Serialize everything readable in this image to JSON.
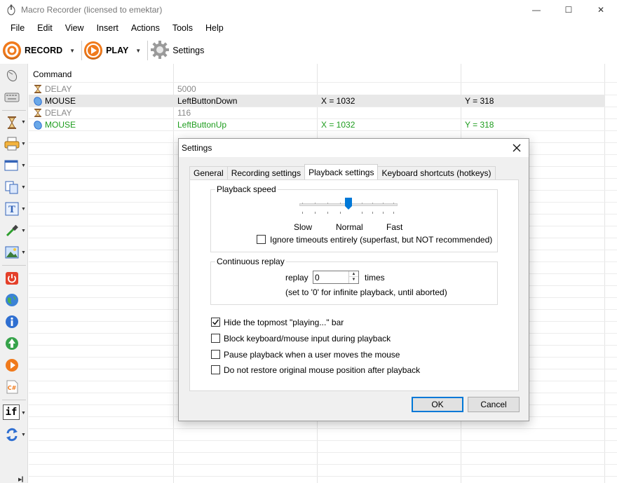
{
  "window": {
    "title": "Macro Recorder (licensed to emektar)",
    "controls": {
      "minimize": "—",
      "maximize": "☐",
      "close": "✕"
    }
  },
  "menubar": [
    "File",
    "Edit",
    "View",
    "Insert",
    "Actions",
    "Tools",
    "Help"
  ],
  "toolbar": {
    "record_label": "RECORD",
    "play_label": "PLAY",
    "settings_label": "Settings",
    "accent": "#f07a1c"
  },
  "sidebar_icons": [
    "mouse-icon",
    "keyboard-icon",
    "hourglass-icon",
    "print-icon",
    "window-icon",
    "copy-icon",
    "text-icon",
    "eyedropper-icon",
    "image-icon",
    "power-icon",
    "web-icon",
    "info-icon",
    "recycle-icon",
    "play-icon",
    "csharp-icon",
    "if-icon",
    "loop-icon"
  ],
  "sidebar_text": {
    "if_label": "if"
  },
  "grid": {
    "header": "Command",
    "rows": [
      {
        "type": "DELAY",
        "icon": "hourglass-icon",
        "c2": "5000",
        "c3": "",
        "c4": "",
        "style": "gray",
        "selected": false
      },
      {
        "type": "MOUSE",
        "icon": "mouse-icon",
        "c2": "LeftButtonDown",
        "c3": "X = 1032",
        "c4": "Y = 318",
        "style": "normal",
        "selected": true
      },
      {
        "type": "DELAY",
        "icon": "hourglass-icon",
        "c2": "116",
        "c3": "",
        "c4": "",
        "style": "gray",
        "selected": false
      },
      {
        "type": "MOUSE",
        "icon": "mouse-icon",
        "c2": "LeftButtonUp",
        "c3": "X = 1032",
        "c4": "Y = 318",
        "style": "green",
        "selected": false
      }
    ]
  },
  "dialog": {
    "title": "Settings",
    "tabs": [
      "General",
      "Recording settings",
      "Playback settings",
      "Keyboard shortcuts (hotkeys)"
    ],
    "active_tab": 2,
    "playback_speed": {
      "legend": "Playback speed",
      "slow": "Slow",
      "normal": "Normal",
      "fast": "Fast",
      "ignore_timeouts_label": "Ignore timeouts entirely (superfast, but NOT recommended)",
      "ignore_timeouts_checked": false
    },
    "continuous_replay": {
      "legend": "Continuous replay",
      "replay_label": "replay",
      "value": "0",
      "times_label": "times",
      "hint": "(set to '0' for infinite playback, until aborted)"
    },
    "options": [
      {
        "label": "Hide the topmost \"playing...\" bar",
        "checked": true
      },
      {
        "label": "Block keyboard/mouse input during playback",
        "checked": false
      },
      {
        "label": "Pause playback when a user moves the mouse",
        "checked": false
      },
      {
        "label": "Do not restore original mouse position after playback",
        "checked": false
      }
    ],
    "ok_label": "OK",
    "cancel_label": "Cancel"
  }
}
